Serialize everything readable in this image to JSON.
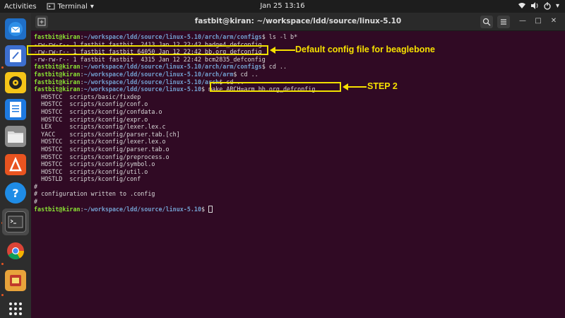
{
  "topbar": {
    "activities": "Activities",
    "app_name": "Terminal",
    "clock": "Jan 25  13:16"
  },
  "window": {
    "title": "fastbit@kiran: ~/workspace/ldd/source/linux-5.10"
  },
  "terminal": {
    "prompt_user": "fastbit@kiran",
    "lines": [
      {
        "path": "~/workspace/ldd/source/linux-5.10/arch/arm/configs",
        "cmd": " ls -l b*"
      },
      {
        "text": "-rw-rw-r-- 1 fastbit fastbit  2413 Jan 12 22:42 badge4_defconfig"
      },
      {
        "text": "-rw-rw-r-- 1 fastbit fastbit 64050 Jan 12 22:42 bb.org_defconfig"
      },
      {
        "text": "-rw-rw-r-- 1 fastbit fastbit  4315 Jan 12 22:42 bcm2835_defconfig"
      },
      {
        "path": "~/workspace/ldd/source/linux-5.10/arch/arm/configs",
        "cmd": " cd .."
      },
      {
        "path": "~/workspace/ldd/source/linux-5.10/arch/arm",
        "cmd": " cd .."
      },
      {
        "path": "~/workspace/ldd/source/linux-5.10/arch",
        "cmd": " cd .."
      },
      {
        "path": "~/workspace/ldd/source/linux-5.10",
        "cmd": " make ARCH=arm bb.org_defconfig"
      },
      {
        "text": "  HOSTCC  scripts/basic/fixdep"
      },
      {
        "text": "  HOSTCC  scripts/kconfig/conf.o"
      },
      {
        "text": "  HOSTCC  scripts/kconfig/confdata.o"
      },
      {
        "text": "  HOSTCC  scripts/kconfig/expr.o"
      },
      {
        "text": "  LEX     scripts/kconfig/lexer.lex.c"
      },
      {
        "text": "  YACC    scripts/kconfig/parser.tab.[ch]"
      },
      {
        "text": "  HOSTCC  scripts/kconfig/lexer.lex.o"
      },
      {
        "text": "  HOSTCC  scripts/kconfig/parser.tab.o"
      },
      {
        "text": "  HOSTCC  scripts/kconfig/preprocess.o"
      },
      {
        "text": "  HOSTCC  scripts/kconfig/symbol.o"
      },
      {
        "text": "  HOSTCC  scripts/kconfig/util.o"
      },
      {
        "text": "  HOSTLD  scripts/kconfig/conf"
      },
      {
        "text": "#"
      },
      {
        "text": "# configuration written to .config"
      },
      {
        "text": "#"
      },
      {
        "path": "~/workspace/ldd/source/linux-5.10",
        "cmd": " ",
        "cursor": true
      }
    ]
  },
  "annotations": {
    "config_note": "Default config file for beaglebone",
    "step_note": "STEP 2"
  },
  "dock": {
    "apps": [
      "thunderbird-icon",
      "text-editor-icon",
      "rhythmbox-icon",
      "writer-icon",
      "files-icon",
      "software-icon",
      "help-icon",
      "terminal-icon",
      "chrome-icon",
      "files-archive-icon",
      "app-grid-icon"
    ]
  },
  "colors": {
    "terminal_bg": "#300a24",
    "prompt_user": "#8ae234",
    "prompt_path": "#729fcf",
    "annotation": "#f6e000"
  }
}
